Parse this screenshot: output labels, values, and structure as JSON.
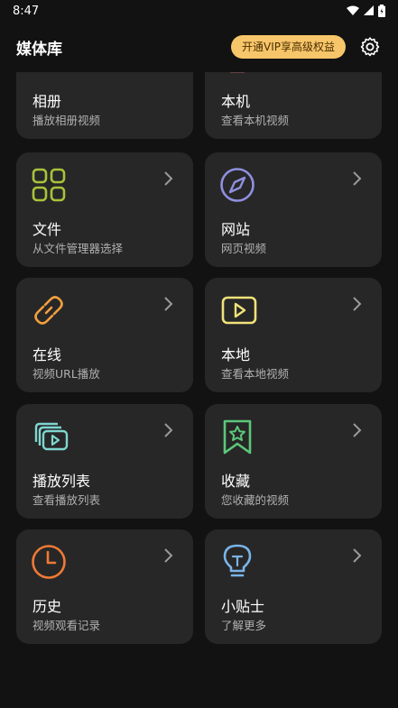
{
  "status": {
    "time": "8:47"
  },
  "header": {
    "title": "媒体库",
    "vip_label": "开通VIP享高级权益"
  },
  "cards": [
    {
      "title": "相册",
      "subtitle": "播放相册视频",
      "icon": "album-icon",
      "color": "#5bc0de"
    },
    {
      "title": "本机",
      "subtitle": "查看本机视频",
      "icon": "device-icon",
      "color": "#f08080"
    },
    {
      "title": "文件",
      "subtitle": "从文件管理器选择",
      "icon": "grid-icon",
      "color": "#a8c23a"
    },
    {
      "title": "网站",
      "subtitle": "网页视频",
      "icon": "compass-icon",
      "color": "#8f8fe0"
    },
    {
      "title": "在线",
      "subtitle": "视频URL播放",
      "icon": "link-icon",
      "color": "#f2a03d"
    },
    {
      "title": "本地",
      "subtitle": "查看本地视频",
      "icon": "play-box-icon",
      "color": "#f0e27a"
    },
    {
      "title": "播放列表",
      "subtitle": "查看播放列表",
      "icon": "playlist-icon",
      "color": "#7fd6d0"
    },
    {
      "title": "收藏",
      "subtitle": "您收藏的视频",
      "icon": "bookmark-star-icon",
      "color": "#5cc87a"
    },
    {
      "title": "历史",
      "subtitle": "视频观看记录",
      "icon": "clock-icon",
      "color": "#f07a35"
    },
    {
      "title": "小贴士",
      "subtitle": "了解更多",
      "icon": "lightbulb-icon",
      "color": "#7ab4e8"
    }
  ]
}
